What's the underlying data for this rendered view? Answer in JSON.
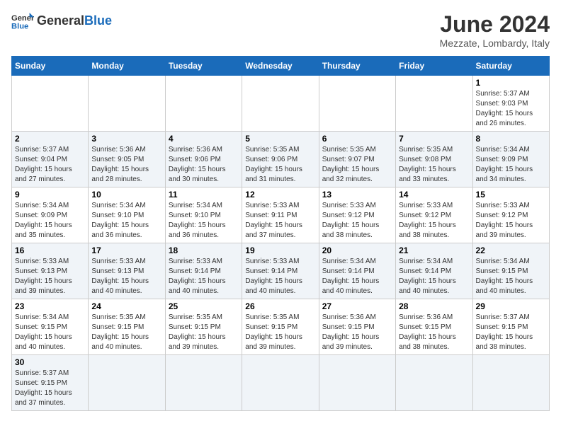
{
  "header": {
    "logo_general": "General",
    "logo_blue": "Blue",
    "month_title": "June 2024",
    "subtitle": "Mezzate, Lombardy, Italy"
  },
  "days_of_week": [
    "Sunday",
    "Monday",
    "Tuesday",
    "Wednesday",
    "Thursday",
    "Friday",
    "Saturday"
  ],
  "weeks": [
    [
      {
        "day": "",
        "info": ""
      },
      {
        "day": "",
        "info": ""
      },
      {
        "day": "",
        "info": ""
      },
      {
        "day": "",
        "info": ""
      },
      {
        "day": "",
        "info": ""
      },
      {
        "day": "",
        "info": ""
      },
      {
        "day": "1",
        "info": "Sunrise: 5:37 AM\nSunset: 9:03 PM\nDaylight: 15 hours and 26 minutes."
      }
    ],
    [
      {
        "day": "2",
        "info": "Sunrise: 5:37 AM\nSunset: 9:04 PM\nDaylight: 15 hours and 27 minutes."
      },
      {
        "day": "3",
        "info": "Sunrise: 5:36 AM\nSunset: 9:05 PM\nDaylight: 15 hours and 28 minutes."
      },
      {
        "day": "4",
        "info": "Sunrise: 5:36 AM\nSunset: 9:06 PM\nDaylight: 15 hours and 30 minutes."
      },
      {
        "day": "5",
        "info": "Sunrise: 5:35 AM\nSunset: 9:06 PM\nDaylight: 15 hours and 31 minutes."
      },
      {
        "day": "6",
        "info": "Sunrise: 5:35 AM\nSunset: 9:07 PM\nDaylight: 15 hours and 32 minutes."
      },
      {
        "day": "7",
        "info": "Sunrise: 5:35 AM\nSunset: 9:08 PM\nDaylight: 15 hours and 33 minutes."
      },
      {
        "day": "8",
        "info": "Sunrise: 5:34 AM\nSunset: 9:09 PM\nDaylight: 15 hours and 34 minutes."
      }
    ],
    [
      {
        "day": "9",
        "info": "Sunrise: 5:34 AM\nSunset: 9:09 PM\nDaylight: 15 hours and 35 minutes."
      },
      {
        "day": "10",
        "info": "Sunrise: 5:34 AM\nSunset: 9:10 PM\nDaylight: 15 hours and 36 minutes."
      },
      {
        "day": "11",
        "info": "Sunrise: 5:34 AM\nSunset: 9:10 PM\nDaylight: 15 hours and 36 minutes."
      },
      {
        "day": "12",
        "info": "Sunrise: 5:33 AM\nSunset: 9:11 PM\nDaylight: 15 hours and 37 minutes."
      },
      {
        "day": "13",
        "info": "Sunrise: 5:33 AM\nSunset: 9:12 PM\nDaylight: 15 hours and 38 minutes."
      },
      {
        "day": "14",
        "info": "Sunrise: 5:33 AM\nSunset: 9:12 PM\nDaylight: 15 hours and 38 minutes."
      },
      {
        "day": "15",
        "info": "Sunrise: 5:33 AM\nSunset: 9:12 PM\nDaylight: 15 hours and 39 minutes."
      }
    ],
    [
      {
        "day": "16",
        "info": "Sunrise: 5:33 AM\nSunset: 9:13 PM\nDaylight: 15 hours and 39 minutes."
      },
      {
        "day": "17",
        "info": "Sunrise: 5:33 AM\nSunset: 9:13 PM\nDaylight: 15 hours and 40 minutes."
      },
      {
        "day": "18",
        "info": "Sunrise: 5:33 AM\nSunset: 9:14 PM\nDaylight: 15 hours and 40 minutes."
      },
      {
        "day": "19",
        "info": "Sunrise: 5:33 AM\nSunset: 9:14 PM\nDaylight: 15 hours and 40 minutes."
      },
      {
        "day": "20",
        "info": "Sunrise: 5:34 AM\nSunset: 9:14 PM\nDaylight: 15 hours and 40 minutes."
      },
      {
        "day": "21",
        "info": "Sunrise: 5:34 AM\nSunset: 9:14 PM\nDaylight: 15 hours and 40 minutes."
      },
      {
        "day": "22",
        "info": "Sunrise: 5:34 AM\nSunset: 9:15 PM\nDaylight: 15 hours and 40 minutes."
      }
    ],
    [
      {
        "day": "23",
        "info": "Sunrise: 5:34 AM\nSunset: 9:15 PM\nDaylight: 15 hours and 40 minutes."
      },
      {
        "day": "24",
        "info": "Sunrise: 5:35 AM\nSunset: 9:15 PM\nDaylight: 15 hours and 40 minutes."
      },
      {
        "day": "25",
        "info": "Sunrise: 5:35 AM\nSunset: 9:15 PM\nDaylight: 15 hours and 39 minutes."
      },
      {
        "day": "26",
        "info": "Sunrise: 5:35 AM\nSunset: 9:15 PM\nDaylight: 15 hours and 39 minutes."
      },
      {
        "day": "27",
        "info": "Sunrise: 5:36 AM\nSunset: 9:15 PM\nDaylight: 15 hours and 39 minutes."
      },
      {
        "day": "28",
        "info": "Sunrise: 5:36 AM\nSunset: 9:15 PM\nDaylight: 15 hours and 38 minutes."
      },
      {
        "day": "29",
        "info": "Sunrise: 5:37 AM\nSunset: 9:15 PM\nDaylight: 15 hours and 38 minutes."
      }
    ],
    [
      {
        "day": "30",
        "info": "Sunrise: 5:37 AM\nSunset: 9:15 PM\nDaylight: 15 hours and 37 minutes."
      },
      {
        "day": "",
        "info": ""
      },
      {
        "day": "",
        "info": ""
      },
      {
        "day": "",
        "info": ""
      },
      {
        "day": "",
        "info": ""
      },
      {
        "day": "",
        "info": ""
      },
      {
        "day": "",
        "info": ""
      }
    ]
  ]
}
